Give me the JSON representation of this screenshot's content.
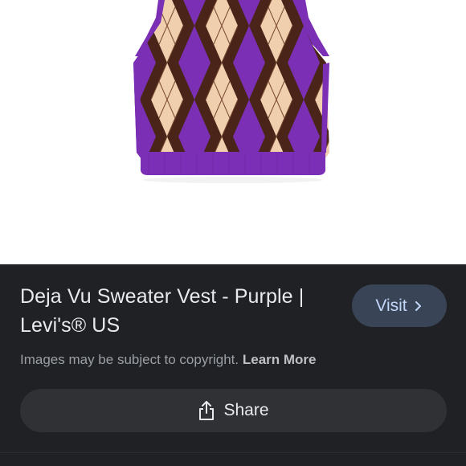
{
  "result": {
    "title": "Deja Vu Sweater Vest - Purple | Levi's® US",
    "visit_label": "Visit",
    "copyright_text": "Images may be subject to copyright.",
    "learn_more_label": "Learn More",
    "share_label": "Share"
  },
  "icons": {
    "visit": "chevron-right-icon",
    "share": "share-icon"
  },
  "colors": {
    "panel_bg": "#202124",
    "visit_bg": "#394457",
    "visit_text": "#c2d6f8",
    "share_bg": "#303134",
    "vest_purple": "#7a2fb4",
    "vest_brown": "#4a2418",
    "vest_beige": "#efcfae"
  }
}
